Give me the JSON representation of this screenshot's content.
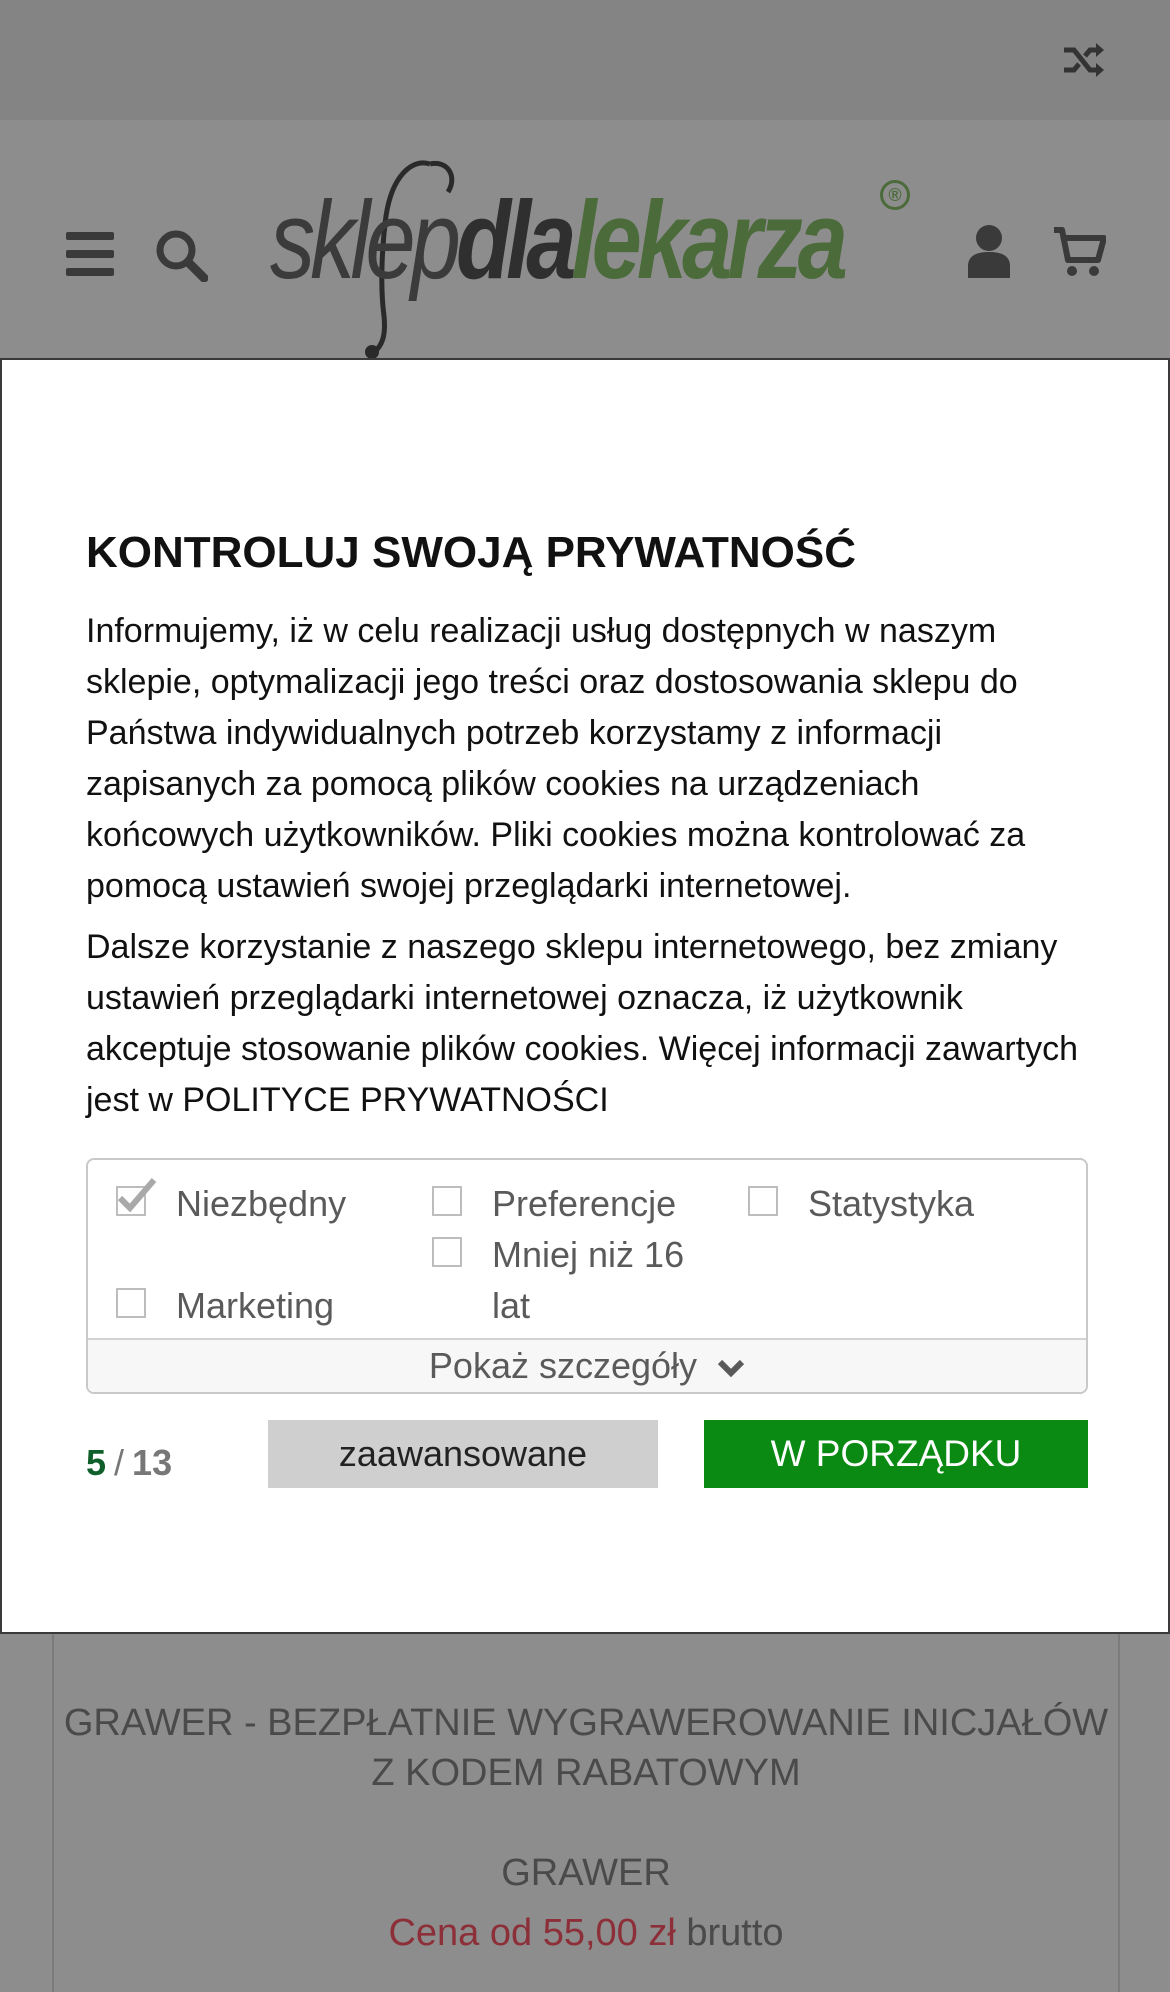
{
  "header": {
    "logo": {
      "part1": "sklep",
      "part2": "dla",
      "part3": "lekarza",
      "registered": "®"
    },
    "icons": [
      "shuffle-icon",
      "menu-icon",
      "search-icon",
      "user-icon",
      "cart-icon"
    ]
  },
  "modal": {
    "title": "KONTROLUJ SWOJĄ PRYWATNOŚĆ",
    "paragraph1": "Informujemy, iż w celu realizacji usług dostępnych w naszym sklepie, optymalizacji jego treści oraz dostosowania sklepu do Państwa indywidualnych potrzeb korzystamy z informacji zapisanych za pomocą plików cookies na urządzeniach końcowych użytkowników. Pliki cookies można kontrolować za pomocą ustawień swojej przeglądarki internetowej.",
    "paragraph2": "Dalsze korzystanie z naszego sklepu internetowego, bez zmiany ustawień przeglądarki internetowej oznacza, iż użytkownik akceptuje stosowanie plików cookies. Więcej informacji zawartych jest w POLITYCE PRYWATNOŚCI",
    "consents": {
      "necessary": {
        "label": "Niezbędny",
        "checked": true
      },
      "preferences": {
        "label": "Preferencje",
        "checked": false
      },
      "statistics": {
        "label": "Statystyka",
        "checked": false
      },
      "under16": {
        "label": "Mniej niż 16 lat",
        "checked": false
      },
      "marketing": {
        "label": "Marketing",
        "checked": false
      }
    },
    "show_details": "Pokaż szczegóły",
    "counter": {
      "current": "5",
      "separator": "/",
      "total": "13"
    },
    "advanced_button": "zaawansowane",
    "ok_button": "W PORZĄDKU"
  },
  "product": {
    "title": "GRAWER - BEZPŁATNIE WYGRAWEROWANIE INICJAŁÓW Z KODEM RABATOWYM",
    "name": "GRAWER",
    "price_amount": "Cena od 55,00 zł",
    "price_suffix": "brutto"
  },
  "colors": {
    "accent_green": "#0a8a13",
    "counter_green": "#0f5f2a",
    "price_red": "#8c2f38"
  }
}
